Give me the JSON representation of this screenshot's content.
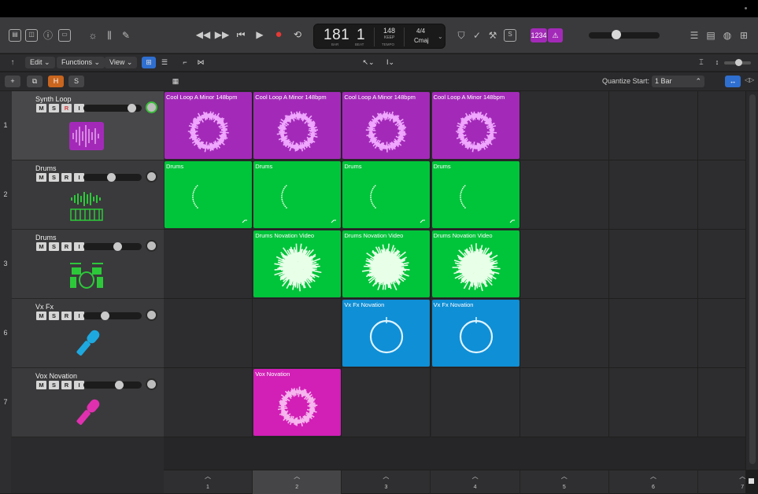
{
  "toolbar": {
    "lcd": {
      "bar": "181",
      "beat": "1",
      "bar_caption": "BAR",
      "beat_caption": "BEAT",
      "tempo": "148",
      "tempo_mode": "KEEP",
      "tempo_caption": "TEMPO",
      "signature": "4/4",
      "key": "Cmaj"
    },
    "count_in": "1234",
    "tuner_label": "⚠"
  },
  "subbar": {
    "edit": "Edit",
    "functions": "Functions",
    "view": "View"
  },
  "header": {
    "add": "+",
    "h_label": "H",
    "s_label": "S",
    "quantize_label": "Quantize Start:",
    "quantize_value": "1 Bar"
  },
  "tracks": [
    {
      "num": "1",
      "name": "Synth Loop",
      "color": "#a32ab8",
      "icon": "waveform-icon",
      "msri": [
        "M",
        "S",
        "R",
        "I"
      ]
    },
    {
      "num": "2",
      "name": "Drums",
      "color": "#2dc83a",
      "icon": "drum-machine-icon",
      "msri": [
        "M",
        "S",
        "R",
        "I"
      ]
    },
    {
      "num": "3",
      "name": "Drums",
      "color": "#2dc83a",
      "icon": "drum-kit-icon",
      "msri": [
        "M",
        "S",
        "R",
        "I"
      ]
    },
    {
      "num": "6",
      "name": "Vx Fx",
      "color": "#1ea8e0",
      "icon": "microphone-icon",
      "msri": [
        "M",
        "S",
        "R",
        "I"
      ]
    },
    {
      "num": "7",
      "name": "Vox Novation",
      "color": "#e030b0",
      "icon": "microphone-icon",
      "msri": [
        "M",
        "S",
        "R",
        "I"
      ]
    }
  ],
  "clips": {
    "row1": "Cool Loop A Minor 148bpm",
    "row2": "Drums",
    "row3": "Drums Novation Video",
    "row4": "Vx Fx Novation",
    "row5": "Vox Novation"
  },
  "colors": {
    "purple": "#a32ab8",
    "green": "#00c43a",
    "blue": "#0f8fd6",
    "magenta": "#d21fb6"
  },
  "scenes": [
    "1",
    "2",
    "3",
    "4",
    "5",
    "6",
    "7"
  ]
}
